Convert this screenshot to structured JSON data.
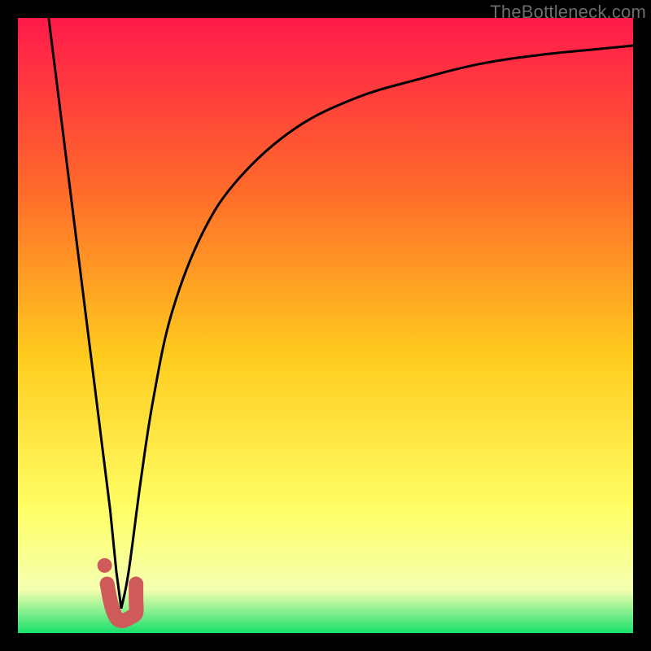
{
  "watermark": "TheBottleneck.com",
  "colors": {
    "frame": "#000000",
    "gradient_top": "#ff1a4b",
    "gradient_mid1": "#ff6a2a",
    "gradient_mid2": "#ffcc1e",
    "gradient_mid3": "#ffff66",
    "gradient_mid4": "#f4ffb0",
    "gradient_bottom": "#18e06b",
    "curve": "#000000",
    "marker": "#cf5a5a"
  },
  "chart_data": {
    "type": "line",
    "title": "",
    "xlabel": "",
    "ylabel": "",
    "xlim": [
      0,
      100
    ],
    "ylim": [
      0,
      100
    ],
    "series": [
      {
        "name": "bottleneck-curve-left",
        "x": [
          5,
          7.5,
          10,
          12.5,
          15,
          16,
          16.8
        ],
        "values": [
          100,
          80,
          60,
          40,
          20,
          10,
          4
        ]
      },
      {
        "name": "bottleneck-curve-right",
        "x": [
          16.8,
          18,
          20,
          22,
          25,
          30,
          36,
          45,
          55,
          65,
          75,
          85,
          95,
          100
        ],
        "values": [
          4,
          10,
          25,
          38,
          52,
          65,
          74,
          82,
          87,
          90,
          92.5,
          94,
          95,
          95.5
        ]
      },
      {
        "name": "optimal-marker",
        "x": [
          14.5,
          15.2,
          16,
          16.8,
          17.6,
          18.4,
          19.2,
          19.2,
          19.2
        ],
        "values": [
          8,
          4.5,
          2.5,
          2,
          2.2,
          2.6,
          3.3,
          5.5,
          8
        ]
      }
    ],
    "optimum_x": 16.8,
    "annotations": []
  }
}
